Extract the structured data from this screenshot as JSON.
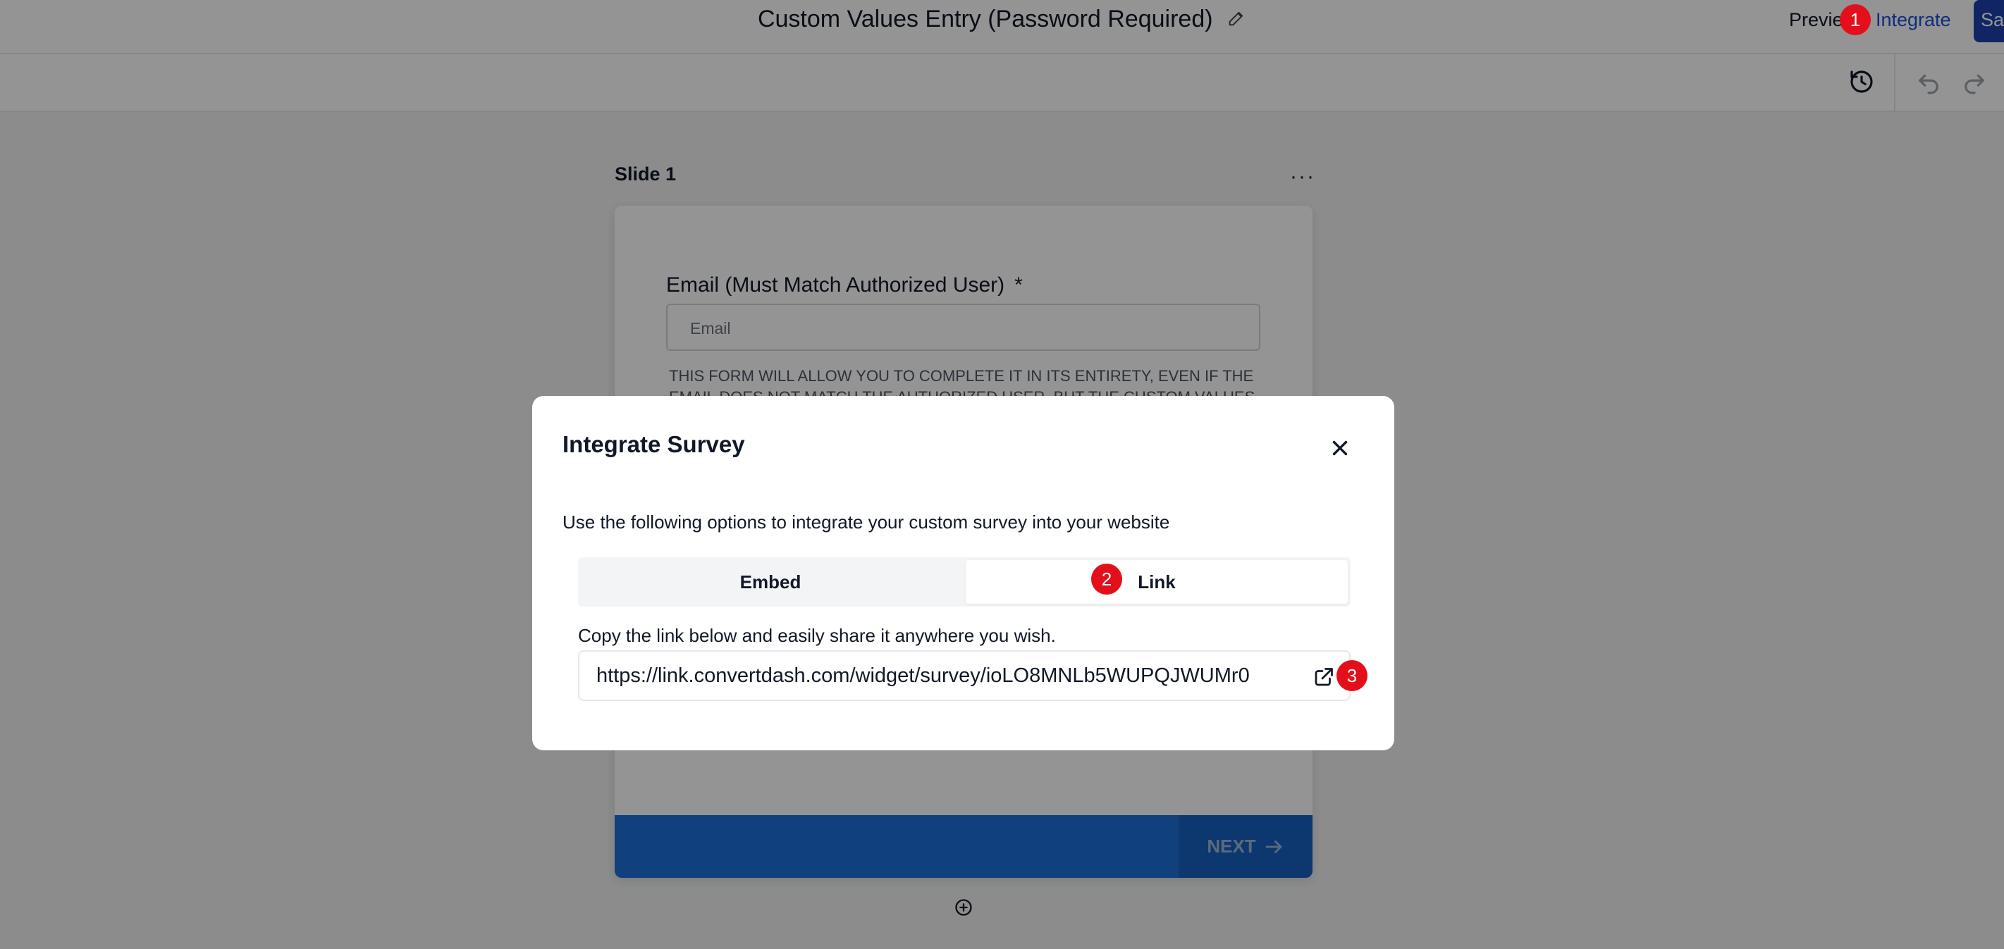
{
  "header": {
    "title": "Custom Values Entry (Password Required)",
    "preview_label": "Previe",
    "integrate_label": "Integrate",
    "save_label": "Sa"
  },
  "toolbar": {
    "icons": [
      "history-icon",
      "undo-icon",
      "redo-icon"
    ]
  },
  "canvas": {
    "slide_label": "Slide 1",
    "slide_menu": "···",
    "email_label": "Email (Must Match Authorized User)",
    "required_mark": "*",
    "email_placeholder": "Email",
    "helper_text": "THIS FORM WILL ALLOW YOU TO COMPLETE IT IN ITS ENTIRETY, EVEN IF THE EMAIL DOES NOT MATCH THE AUTHORIZED USER, BUT THE CUSTOM VALUES",
    "next_label": "NEXT"
  },
  "modal": {
    "title": "Integrate Survey",
    "description": "Use the following options to integrate your custom survey into your website",
    "tabs": [
      {
        "label": "Embed",
        "active": false
      },
      {
        "label": "Link",
        "active": true
      }
    ],
    "link_description": "Copy the link below and easily share it anywhere you wish.",
    "url": "https://link.convertdash.com/widget/survey/ioLO8MNLb5WUPQJWUMr0"
  },
  "annotations": [
    "1",
    "2",
    "3"
  ],
  "colors": {
    "accent": "#1d4ed8",
    "next_bar": "#1c6fd9",
    "badge": "#e3101b"
  }
}
